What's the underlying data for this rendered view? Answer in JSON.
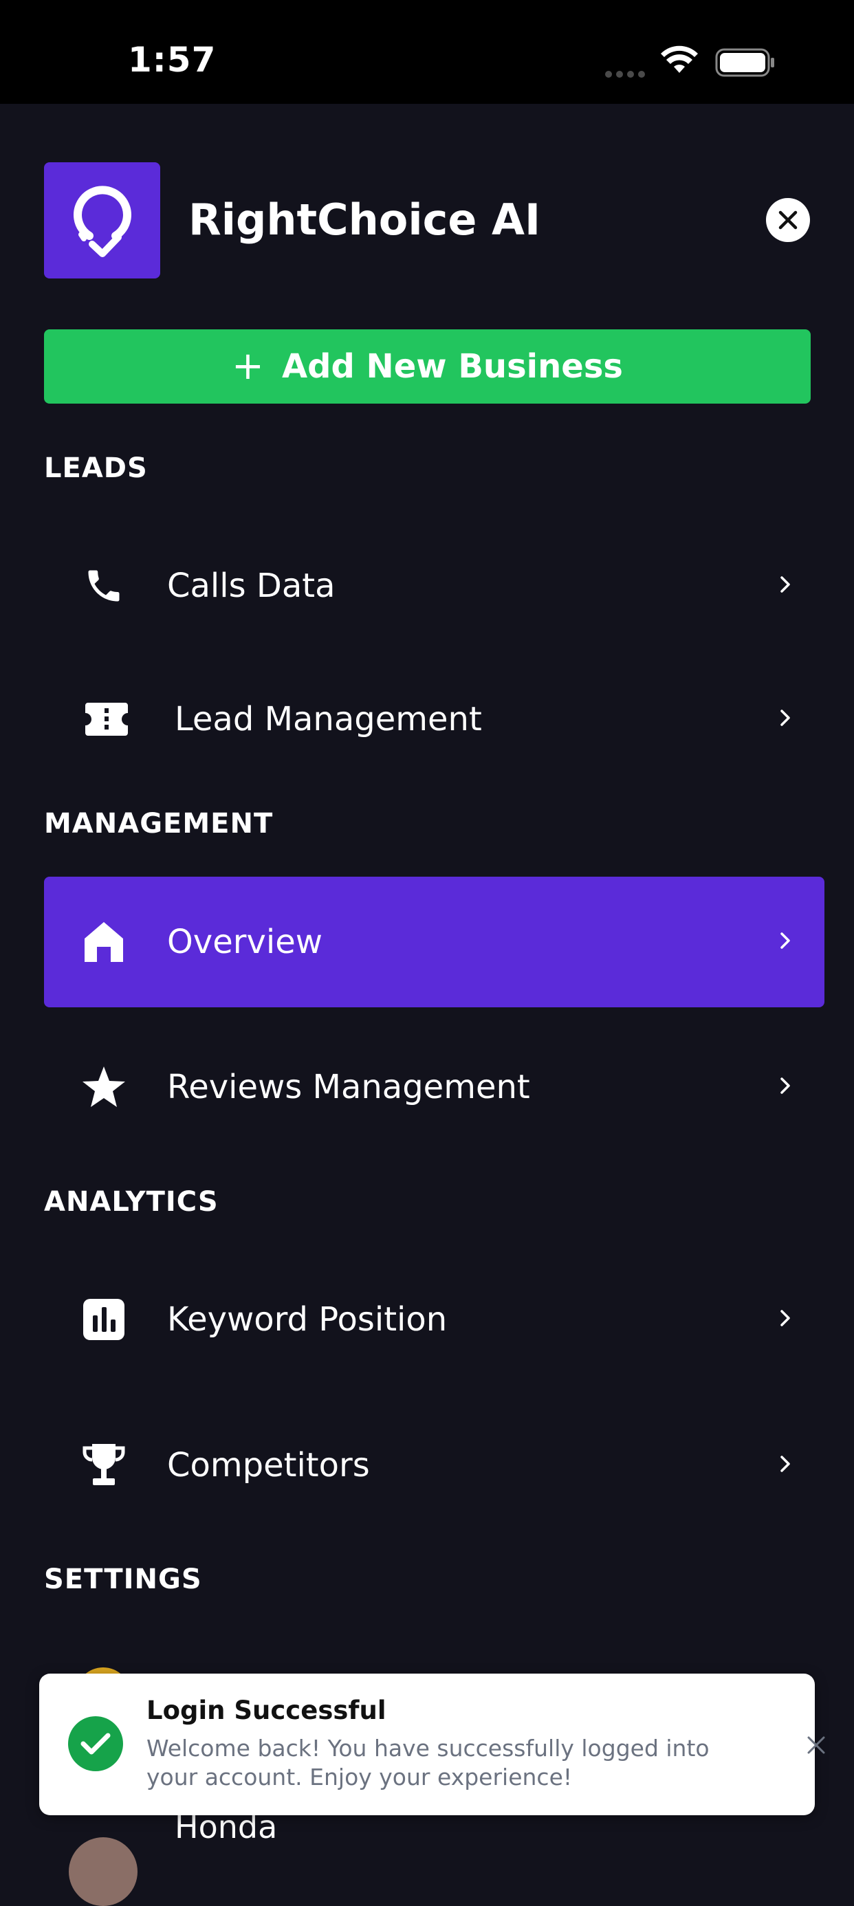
{
  "status_bar": {
    "time": "1:57"
  },
  "header": {
    "app_name": "RightChoice AI",
    "logo_icon": "map-pin-check-icon",
    "close_icon": "close-icon"
  },
  "add_business": {
    "label": "Add New Business",
    "icon": "plus-icon"
  },
  "sections": {
    "leads": "LEADS",
    "management": "MANAGEMENT",
    "analytics": "ANALYTICS",
    "settings": "SETTINGS"
  },
  "menu": {
    "calls_data": {
      "label": "Calls Data",
      "icon": "phone-icon"
    },
    "lead_management": {
      "label": "Lead Management",
      "icon": "ticket-icon"
    },
    "overview": {
      "label": "Overview",
      "icon": "home-icon",
      "active": true
    },
    "reviews_management": {
      "label": "Reviews Management",
      "icon": "star-icon"
    },
    "keyword_position": {
      "label": "Keyword Position",
      "icon": "bar-chart-icon"
    },
    "competitors": {
      "label": "Competitors",
      "icon": "trophy-icon"
    }
  },
  "business": {
    "name": "Honda"
  },
  "toast": {
    "title": "Login Successful",
    "message": "Welcome back! You have successfully logged into your account. Enjoy your experience!"
  },
  "colors": {
    "background": "#12121c",
    "accent": "#5b2bd9",
    "success": "#22c55e"
  }
}
